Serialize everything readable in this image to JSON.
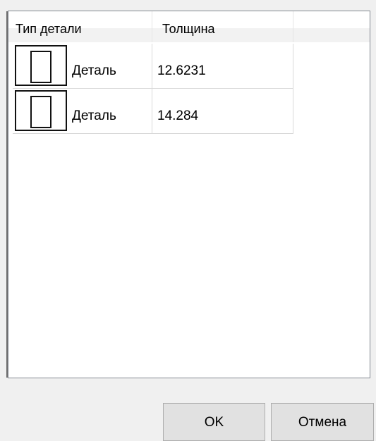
{
  "table": {
    "columns": [
      "Тип детали",
      "Толщина",
      ""
    ],
    "rows": [
      {
        "type_icon": "part-frame-icon",
        "type_label": "Деталь",
        "thickness": "12.6231"
      },
      {
        "type_icon": "part-frame-icon",
        "type_label": "Деталь",
        "thickness": "14.284"
      }
    ]
  },
  "buttons": {
    "ok_label": "OK",
    "cancel_label": "Отмена"
  }
}
